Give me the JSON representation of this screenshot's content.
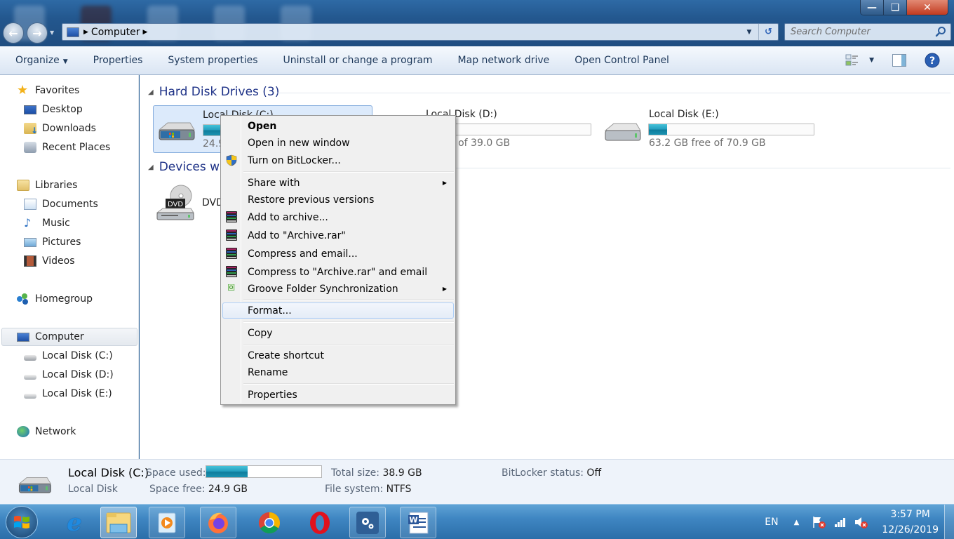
{
  "window": {
    "title_bar_buttons": {
      "minimize": "minimize",
      "maximize": "restore",
      "close": "close"
    },
    "nav": {
      "back": "back-arrow",
      "forward": "forward-arrow"
    },
    "address_bar": {
      "crumbs": [
        "Computer"
      ],
      "icon": "computer-icon"
    },
    "search": {
      "placeholder": "Search Computer",
      "value": ""
    }
  },
  "command_bar": {
    "items": [
      {
        "label": "Organize",
        "has_dropdown": true
      },
      {
        "label": "Properties"
      },
      {
        "label": "System properties"
      },
      {
        "label": "Uninstall or change a program"
      },
      {
        "label": "Map network drive"
      },
      {
        "label": "Open Control Panel"
      }
    ],
    "right_icons": [
      "change-view-icon",
      "view-dropdown-icon",
      "preview-pane-icon",
      "help-icon"
    ]
  },
  "sidebar": {
    "favorites": {
      "label": "Favorites",
      "items": [
        "Desktop",
        "Downloads",
        "Recent Places"
      ]
    },
    "libraries": {
      "label": "Libraries",
      "items": [
        "Documents",
        "Music",
        "Pictures",
        "Videos"
      ]
    },
    "homegroup": {
      "label": "Homegroup"
    },
    "computer": {
      "label": "Computer",
      "selected": true,
      "items": [
        "Local Disk (C:)",
        "Local Disk (D:)",
        "Local Disk (E:)"
      ]
    },
    "network": {
      "label": "Network"
    }
  },
  "main": {
    "groups": [
      {
        "label": "Hard Disk Drives (3)",
        "drives": [
          {
            "name": "Local Disk (C:)",
            "free_text": "24.9 GB free of 38.9 GB",
            "used_fraction": 0.36,
            "selected": true
          },
          {
            "name": "Local Disk (D:)",
            "free_text": "B free of 39.0 GB"
          },
          {
            "name": "Local Disk (E:)",
            "free_text": "63.2 GB free of 70.9 GB",
            "used_fraction": 0.11
          }
        ]
      },
      {
        "label": "Devices wit",
        "devices": [
          {
            "name": "DVD",
            "icon": "dvd-drive-icon"
          }
        ]
      }
    ]
  },
  "context_menu": {
    "items": [
      {
        "label": "Open",
        "bold": true
      },
      {
        "label": "Open in new window"
      },
      {
        "label": "Turn on BitLocker...",
        "icon": "uac-shield-icon"
      },
      {
        "label": "Share with",
        "submenu": true
      },
      {
        "label": "Restore previous versions"
      },
      {
        "label": "Add to archive...",
        "icon": "winrar-icon"
      },
      {
        "label": "Add to \"Archive.rar\"",
        "icon": "winrar-icon"
      },
      {
        "label": "Compress and email...",
        "icon": "winrar-icon"
      },
      {
        "label": "Compress to \"Archive.rar\" and email",
        "icon": "winrar-icon"
      },
      {
        "label": "Groove Folder Synchronization",
        "icon": "groove-icon",
        "submenu": true
      },
      {
        "label": "Format...",
        "highlighted": true
      },
      {
        "label": "Copy"
      },
      {
        "label": "Create shortcut"
      },
      {
        "label": "Rename"
      },
      {
        "label": "Properties"
      }
    ]
  },
  "details_pane": {
    "name": "Local Disk (C:)",
    "type": "Local Disk",
    "space_used_label": "Space used:",
    "space_used_fraction": 0.36,
    "space_free_label": "Space free:",
    "space_free": "24.9 GB",
    "total_size_label": "Total size:",
    "total_size": "38.9 GB",
    "file_system_label": "File system:",
    "file_system": "NTFS",
    "bitlocker_label": "BitLocker status:",
    "bitlocker": "Off"
  },
  "taskbar": {
    "apps": [
      "start-button",
      "internet-explorer",
      "windows-explorer",
      "media-player",
      "firefox",
      "chrome",
      "opera",
      "settings-app",
      "microsoft-word"
    ],
    "tray": {
      "language": "EN",
      "time": "3:57 PM",
      "date": "12/26/2019"
    }
  },
  "colors": {
    "group_header": "#1e3287",
    "bar_fill": "#1b93b2",
    "selection": "#dceafb",
    "taskbar": "#3f86c2"
  }
}
